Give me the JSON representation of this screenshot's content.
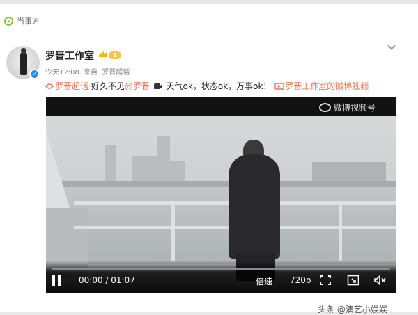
{
  "tag": {
    "label": "当事方"
  },
  "post": {
    "author": "罗晋工作室",
    "level": "1",
    "time": "今天12:08",
    "source_prefix": "来自",
    "source": "罗晋超话",
    "caption": {
      "topic": "罗晋超话",
      "text1": "好久不见",
      "mention": "@罗晋",
      "text2": "天气ok，状态ok，万事ok！",
      "video_link": "罗晋工作室的微博视频"
    }
  },
  "video": {
    "watermark": "微博视频号",
    "time": "00:00 / 01:07",
    "progress": 0.0,
    "speed_label": "倍速",
    "quality_label": "720p"
  },
  "footer": {
    "watermark": "头条 @演艺小娱娱"
  },
  "colors": {
    "link": "#eb7350",
    "accent": "#2d8cf0",
    "level": "#f7c545"
  },
  "icons": [
    "participant-icon",
    "verified-icon",
    "crown-icon",
    "chevron-down-icon",
    "video-link-icon",
    "camera-emoji-icon",
    "pause-icon",
    "fullscreen-icon",
    "pip-icon",
    "volume-mute-icon",
    "weibo-logo-icon"
  ]
}
